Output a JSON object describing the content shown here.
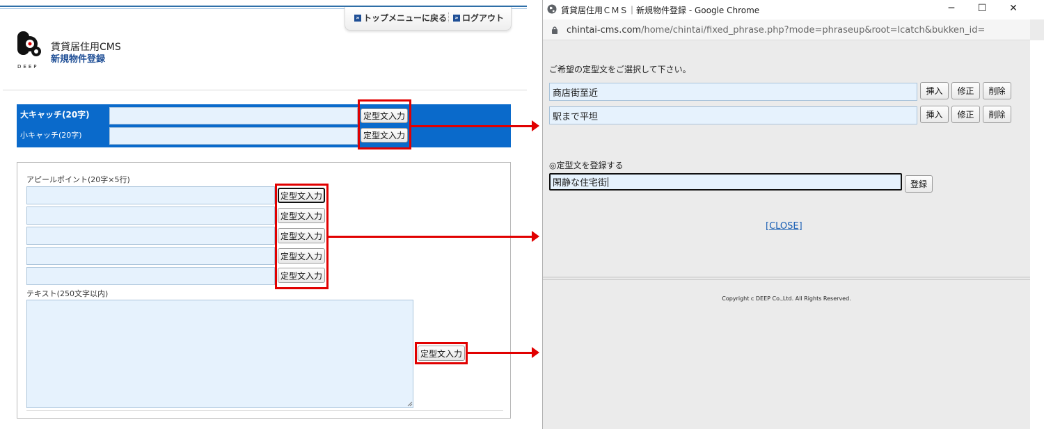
{
  "cms": {
    "top_menu": {
      "back_label": "トップメニューに戻る",
      "logout_label": "ログアウト"
    },
    "logo_text": "DEEP",
    "site_name": "賃貸居住用CMS",
    "page_title": "新規物件登録",
    "catch": {
      "big_label": "大キャッチ(20字)",
      "small_label": "小キャッチ(20字)",
      "button_label": "定型文入力"
    },
    "appeal": {
      "label": "アピールポイント(20字×5行)",
      "button_label": "定型文入力"
    },
    "text": {
      "label": "テキスト(250文字以内)",
      "button_label": "定型文入力"
    }
  },
  "popup": {
    "window_title": "賃貸居住用ＣＭＳ｜新規物件登録 - Google Chrome",
    "url_host": "chintai-cms.com",
    "url_path": "/home/chintai/fixed_phrase.php?mode=phraseup&root=lcatch&bukken_id=",
    "instruction": "ご希望の定型文をご選択して下さい。",
    "phrases": [
      {
        "text": "商店街至近",
        "insert": "挿入",
        "edit": "修正",
        "delete": "削除"
      },
      {
        "text": "駅まで平坦",
        "insert": "挿入",
        "edit": "修正",
        "delete": "削除"
      }
    ],
    "register_label": "◎定型文を登録する",
    "register_value": "閑静な住宅街",
    "register_button": "登録",
    "close_label": "[CLOSE]",
    "copyright": "Copyright c DEEP Co.,Ltd. All Rights Reserved."
  },
  "colors": {
    "catch_band": "#0a6acb",
    "input_fill": "#e6f2fd",
    "highlight_red": "#e10000",
    "title_blue": "#1f4f96"
  }
}
